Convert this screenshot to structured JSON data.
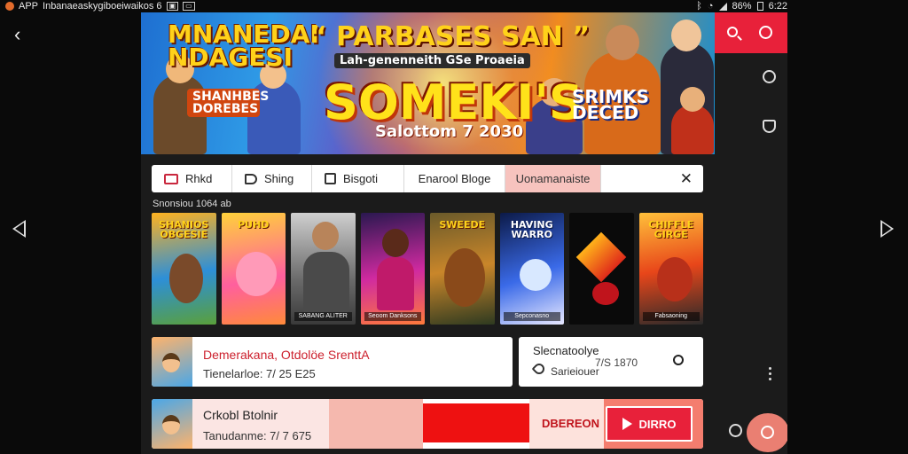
{
  "status_bar": {
    "app_label": "APP",
    "notification_text": "Inbanaeaskygiboeiwaikos 6",
    "battery": "86%",
    "time": "6:22"
  },
  "banner": {
    "top_left_text": "MNANEDAI NDAGESI",
    "quote_text": "“ PARBASES SAN ”",
    "sub_caption": "Lah-genenneith GSe Proaeia",
    "main_title": "SOMEKI'S",
    "date_text": "Salottom 7 2030",
    "left_badge": "SHANHBES DOREBES",
    "right_badge": "SRIMKS DECED"
  },
  "tabs": [
    {
      "label": "Rhkd",
      "icon": "ticket-icon"
    },
    {
      "label": "Shing",
      "icon": "tag-icon"
    },
    {
      "label": "Bisgoti",
      "icon": "box-icon"
    },
    {
      "label": "Enarool Bloge",
      "icon": ""
    },
    {
      "label": "Uonamanaiste",
      "icon": "",
      "active": true
    }
  ],
  "section_label": "Snonsiou 1064 ab",
  "tiles": [
    {
      "title": "SHANIOS OBGESIE",
      "caption": "",
      "colors": [
        "#ffb21f",
        "#2d8fd8",
        "#5aa03a"
      ]
    },
    {
      "title": "PUHD",
      "caption": "",
      "colors": [
        "#ff5f9e",
        "#ffd23a",
        "#ff8a3a"
      ]
    },
    {
      "title": "",
      "caption": "SABANG ALITER",
      "colors": [
        "#6a6a6a",
        "#cfcfcf",
        "#8a7a6a"
      ]
    },
    {
      "title": "",
      "caption": "Seoom Danksons",
      "colors": [
        "#2a1850",
        "#d02aa0",
        "#ff7a3a"
      ]
    },
    {
      "title": "SWEEDE",
      "caption": "",
      "colors": [
        "#2e3a20",
        "#c9862a",
        "#6a5a2a"
      ]
    },
    {
      "title": "HAVING WARRO",
      "caption": "Sepconasno",
      "colors": [
        "#0c1a48",
        "#3a6ae8",
        "#e8e8ff"
      ]
    },
    {
      "title": "",
      "caption": "",
      "colors": [
        "#0a0a0a",
        "#e02a1a",
        "#ffb21a"
      ]
    },
    {
      "title": "CHIFFLE GIRGE",
      "caption": "Fabsaoning",
      "colors": [
        "#2a2a2a",
        "#e8461a",
        "#ffc03a"
      ]
    }
  ],
  "row1": {
    "title": "Demerakana, Otdolöe SrenttA",
    "subtitle": "Tienelarloe: 7/ 25 E25"
  },
  "search_card": {
    "title": "Slecnatoolye",
    "subtitle": "Sarieiouer",
    "value": "7/S 1870"
  },
  "promo": {
    "title": "Crkobl Btolnir",
    "subtitle": "Tanudanme: 7/ 7 675",
    "deal_label": "DBEREON",
    "cta_label": "DIRRO"
  },
  "colors": {
    "accent": "#e8213a",
    "active_tab": "#f7c3be",
    "promo_red": "#ee1111"
  }
}
